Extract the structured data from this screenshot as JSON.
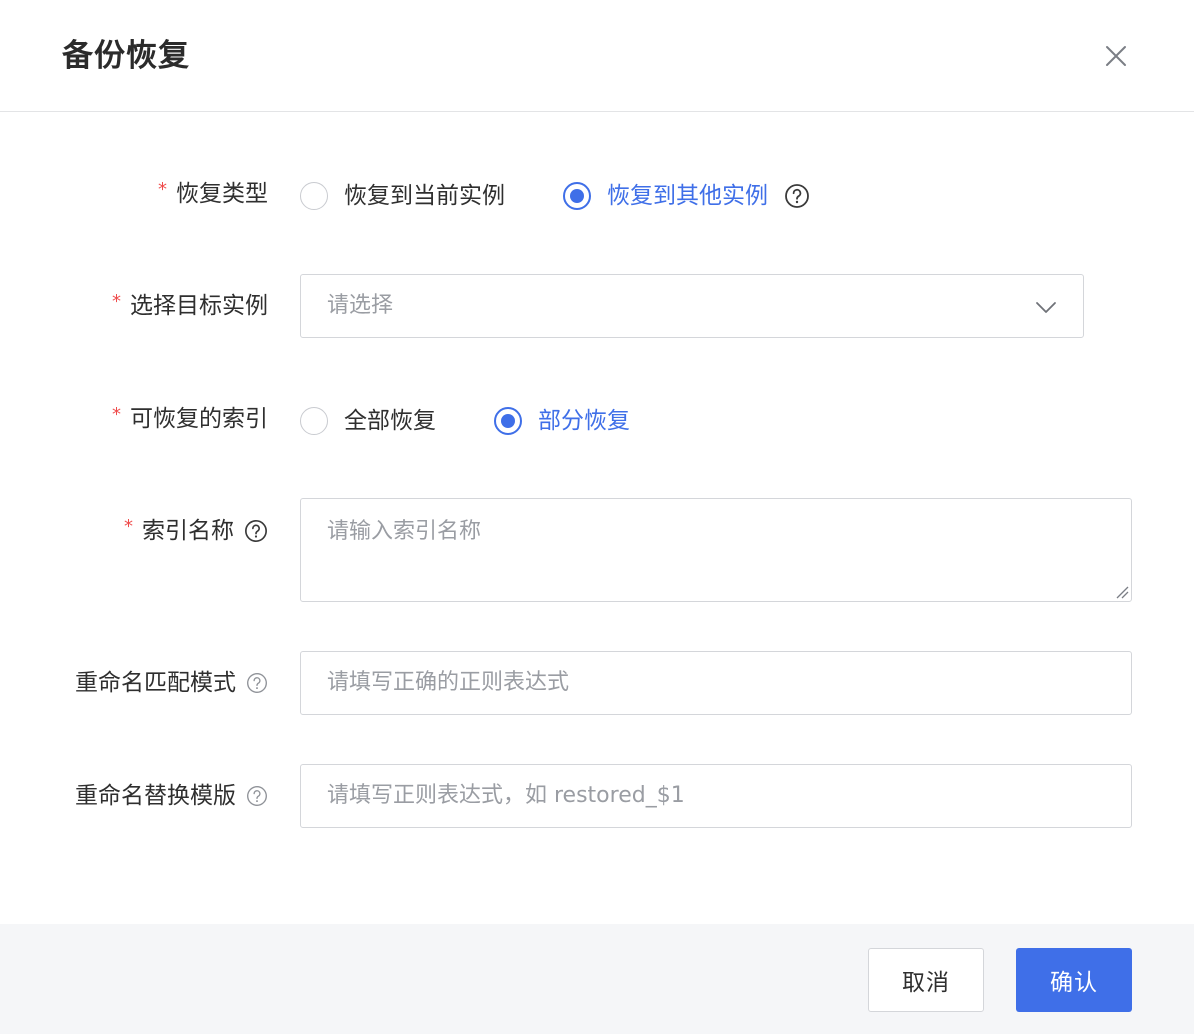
{
  "dialog": {
    "title": "备份恢复"
  },
  "colors": {
    "accent": "#3f6fe8",
    "required": "#ef4b4b",
    "footer_bg": "#f5f6f8"
  },
  "form": {
    "restore_type": {
      "label": "恢复类型",
      "required_mark": "*",
      "options": [
        "恢复到当前实例",
        "恢复到其他实例"
      ],
      "selected": "恢复到其他实例"
    },
    "target_instance": {
      "label": "选择目标实例",
      "required_mark": "*",
      "placeholder": "请选择"
    },
    "restorable_index": {
      "label": "可恢复的索引",
      "required_mark": "*",
      "options": [
        "全部恢复",
        "部分恢复"
      ],
      "selected": "部分恢复"
    },
    "index_name": {
      "label": "索引名称",
      "required_mark": "*",
      "placeholder": "请输入索引名称"
    },
    "rename_pattern": {
      "label": "重命名匹配模式",
      "placeholder": "请填写正确的正则表达式"
    },
    "rename_template": {
      "label": "重命名替换模版",
      "placeholder": "请填写正则表达式，如 restored_$1"
    }
  },
  "footer": {
    "cancel_label": "取消",
    "confirm_label": "确认"
  }
}
